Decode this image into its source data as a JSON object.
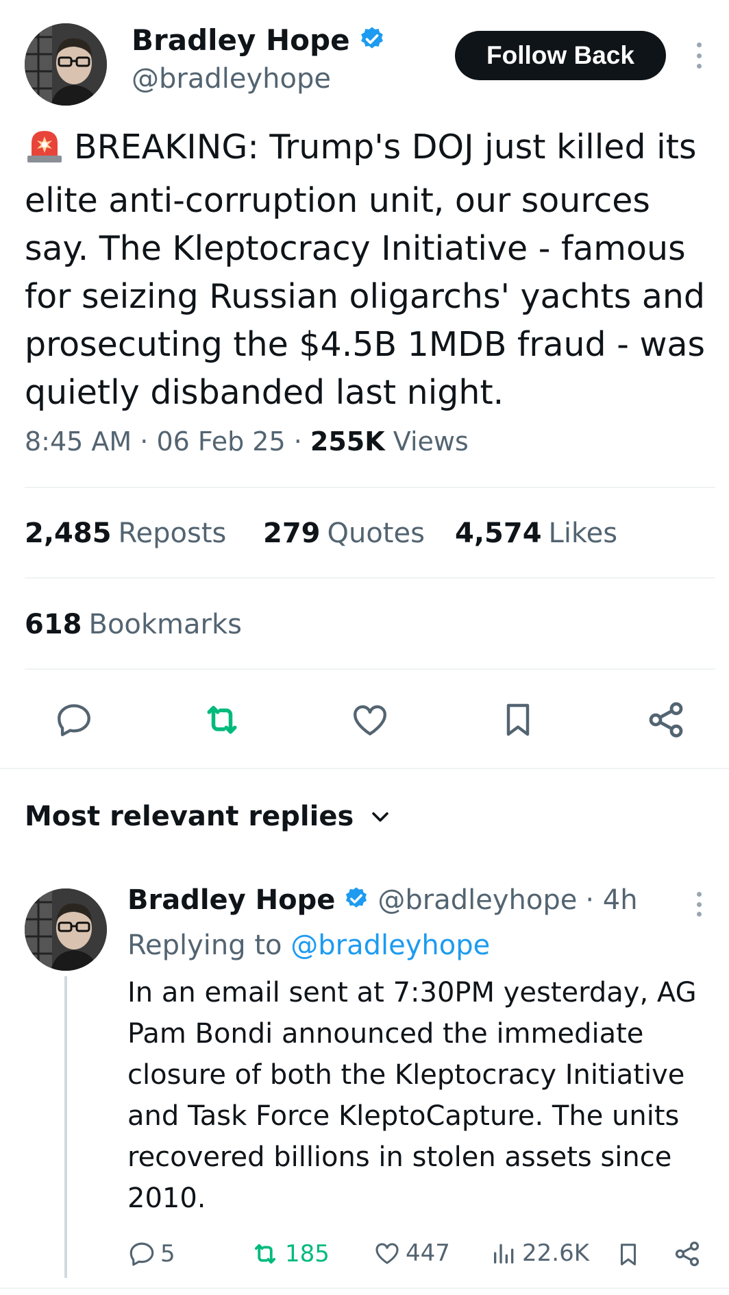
{
  "tweet": {
    "author_name": "Bradley Hope",
    "author_handle": "@bradleyhope",
    "follow_label": "Follow Back",
    "text": "BREAKING: Trump's DOJ just killed its elite anti-corruption unit, our sources say. The Kleptocracy Initiative - famous for seizing Russian oligarchs' yachts and prosecuting the $4.5B 1MDB fraud - was quietly disbanded last night.",
    "emoji_icon": "police-siren-icon",
    "time": "8:45 AM",
    "separator": "·",
    "date": "06 Feb 25",
    "views_count": "255K",
    "views_label": "Views"
  },
  "stats": {
    "reposts_count": "2,485",
    "reposts_label": "Reposts",
    "quotes_count": "279",
    "quotes_label": "Quotes",
    "likes_count": "4,574",
    "likes_label": "Likes",
    "bookmarks_count": "618",
    "bookmarks_label": "Bookmarks"
  },
  "actions": [
    "reply-icon",
    "repost-icon",
    "like-icon",
    "bookmark-icon",
    "share-icon"
  ],
  "replies_section": {
    "title": "Most relevant replies"
  },
  "reply": {
    "author_name": "Bradley Hope",
    "author_handle": "@bradleyhope",
    "time": "· 4h",
    "replying_prefix": "Replying to",
    "replying_handle": "@bradleyhope",
    "text": "In an email sent at 7:30PM yesterday, AG Pam Bondi announced the immediate closure of both the Kleptocracy Initiative and Task Force KleptoCapture. The units recovered billions in stolen assets since 2010.",
    "replies_count": "5",
    "reposts_count": "185",
    "likes_count": "447",
    "views_count": "22.6K"
  },
  "colors": {
    "accent": "#1d9bf0",
    "repost_green": "#00ba7c",
    "text_primary": "#0f1419",
    "text_secondary": "#536471"
  }
}
